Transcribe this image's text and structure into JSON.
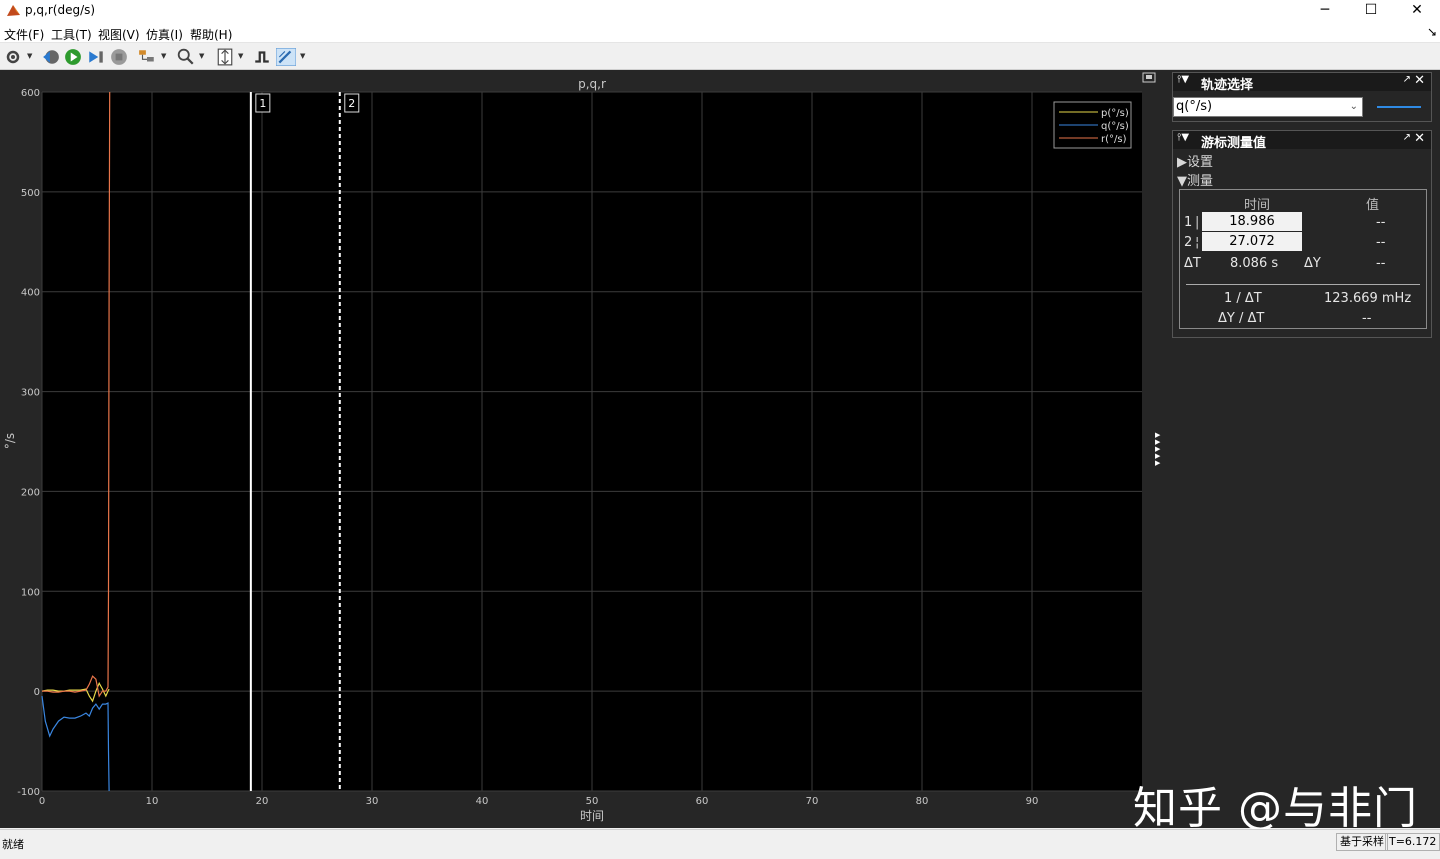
{
  "window": {
    "title": "p,q,r(deg/s)",
    "minimize_glyph": "─",
    "maximize_glyph": "☐",
    "close_glyph": "✕"
  },
  "menu": [
    "文件(F)",
    "工具(T)",
    "视图(V)",
    "仿真(I)",
    "帮助(H)"
  ],
  "toolbar_icons": [
    "settings-icon",
    "step-back-icon",
    "run-icon",
    "step-forward-icon",
    "stop-icon",
    "highlight-icon",
    "zoom-icon",
    "scale-axes-icon",
    "trigger-icon",
    "cursor-measure-icon"
  ],
  "chart_data": {
    "type": "line",
    "title": "p,q,r",
    "xlabel": "时间",
    "ylabel": "°/s",
    "xlim": [
      0,
      100
    ],
    "ylim": [
      -100,
      600
    ],
    "xticks": [
      0,
      10,
      20,
      30,
      40,
      50,
      60,
      70,
      80,
      90
    ],
    "yticks": [
      -100,
      0,
      100,
      200,
      300,
      400,
      500,
      600
    ],
    "grid": true,
    "legend_position": "top-right",
    "series": [
      {
        "name": "p(°/s)",
        "color": "#e6d84a",
        "x": [
          0,
          0.5,
          1,
          1.5,
          2,
          2.5,
          3,
          3.5,
          4,
          4.3,
          4.6,
          4.9,
          5.2,
          5.5,
          5.8,
          6.0,
          6.1
        ],
        "y": [
          0,
          1,
          1,
          0,
          0,
          1,
          1,
          1,
          2,
          -5,
          -10,
          0,
          8,
          2,
          -5,
          0,
          2
        ]
      },
      {
        "name": "q(°/s)",
        "color": "#3a86e0",
        "x": [
          0,
          0.3,
          0.7,
          1.0,
          1.5,
          2.0,
          2.5,
          3.0,
          3.5,
          4.0,
          4.3,
          4.6,
          4.9,
          5.2,
          5.5,
          5.8,
          6.0,
          6.05,
          6.1
        ],
        "y": [
          -5,
          -30,
          -45,
          -38,
          -30,
          -26,
          -27,
          -27,
          -25,
          -22,
          -25,
          -17,
          -13,
          -18,
          -13,
          -13,
          -12,
          -60,
          -100
        ]
      },
      {
        "name": "r(°/s)",
        "color": "#e8754a",
        "x": [
          0,
          0.5,
          1.0,
          1.5,
          2.0,
          2.5,
          3.0,
          3.5,
          4.0,
          4.3,
          4.6,
          4.9,
          5.2,
          5.5,
          5.8,
          6.0,
          6.05,
          6.1,
          6.15
        ],
        "y": [
          0,
          0,
          -1,
          -1,
          0,
          0,
          -1,
          0,
          1,
          7,
          15,
          12,
          -5,
          0,
          0,
          4,
          100,
          400,
          600
        ]
      }
    ],
    "cursors": [
      {
        "label": "1",
        "x": 18.986,
        "style": "solid"
      },
      {
        "label": "2",
        "x": 27.072,
        "style": "dashed"
      }
    ]
  },
  "trace_panel": {
    "title": "轨迹选择",
    "selected": "q(°/s)",
    "line_color": "#2f8ae3"
  },
  "cursor_panel": {
    "title": "游标测量值",
    "settings_label": "▶设置",
    "measure_label": "▼测量",
    "col_time": "时间",
    "col_value": "值",
    "row1_label": "1",
    "row1_time": "18.986",
    "row1_value": "--",
    "row2_label": "2",
    "row2_time": "27.072",
    "row2_value": "--",
    "dt_label": "ΔT",
    "dt_value": "8.086 s",
    "dy_label": "ΔY",
    "dy_value": "--",
    "inv_dt_label": "1 / ΔT",
    "inv_dt_value": "123.669 mHz",
    "dydt_label": "ΔY / ΔT",
    "dydt_value": "--"
  },
  "status": {
    "text": "就绪",
    "mode": "基于采样",
    "time": "T=6.172"
  },
  "watermark": "知乎 @与非门"
}
